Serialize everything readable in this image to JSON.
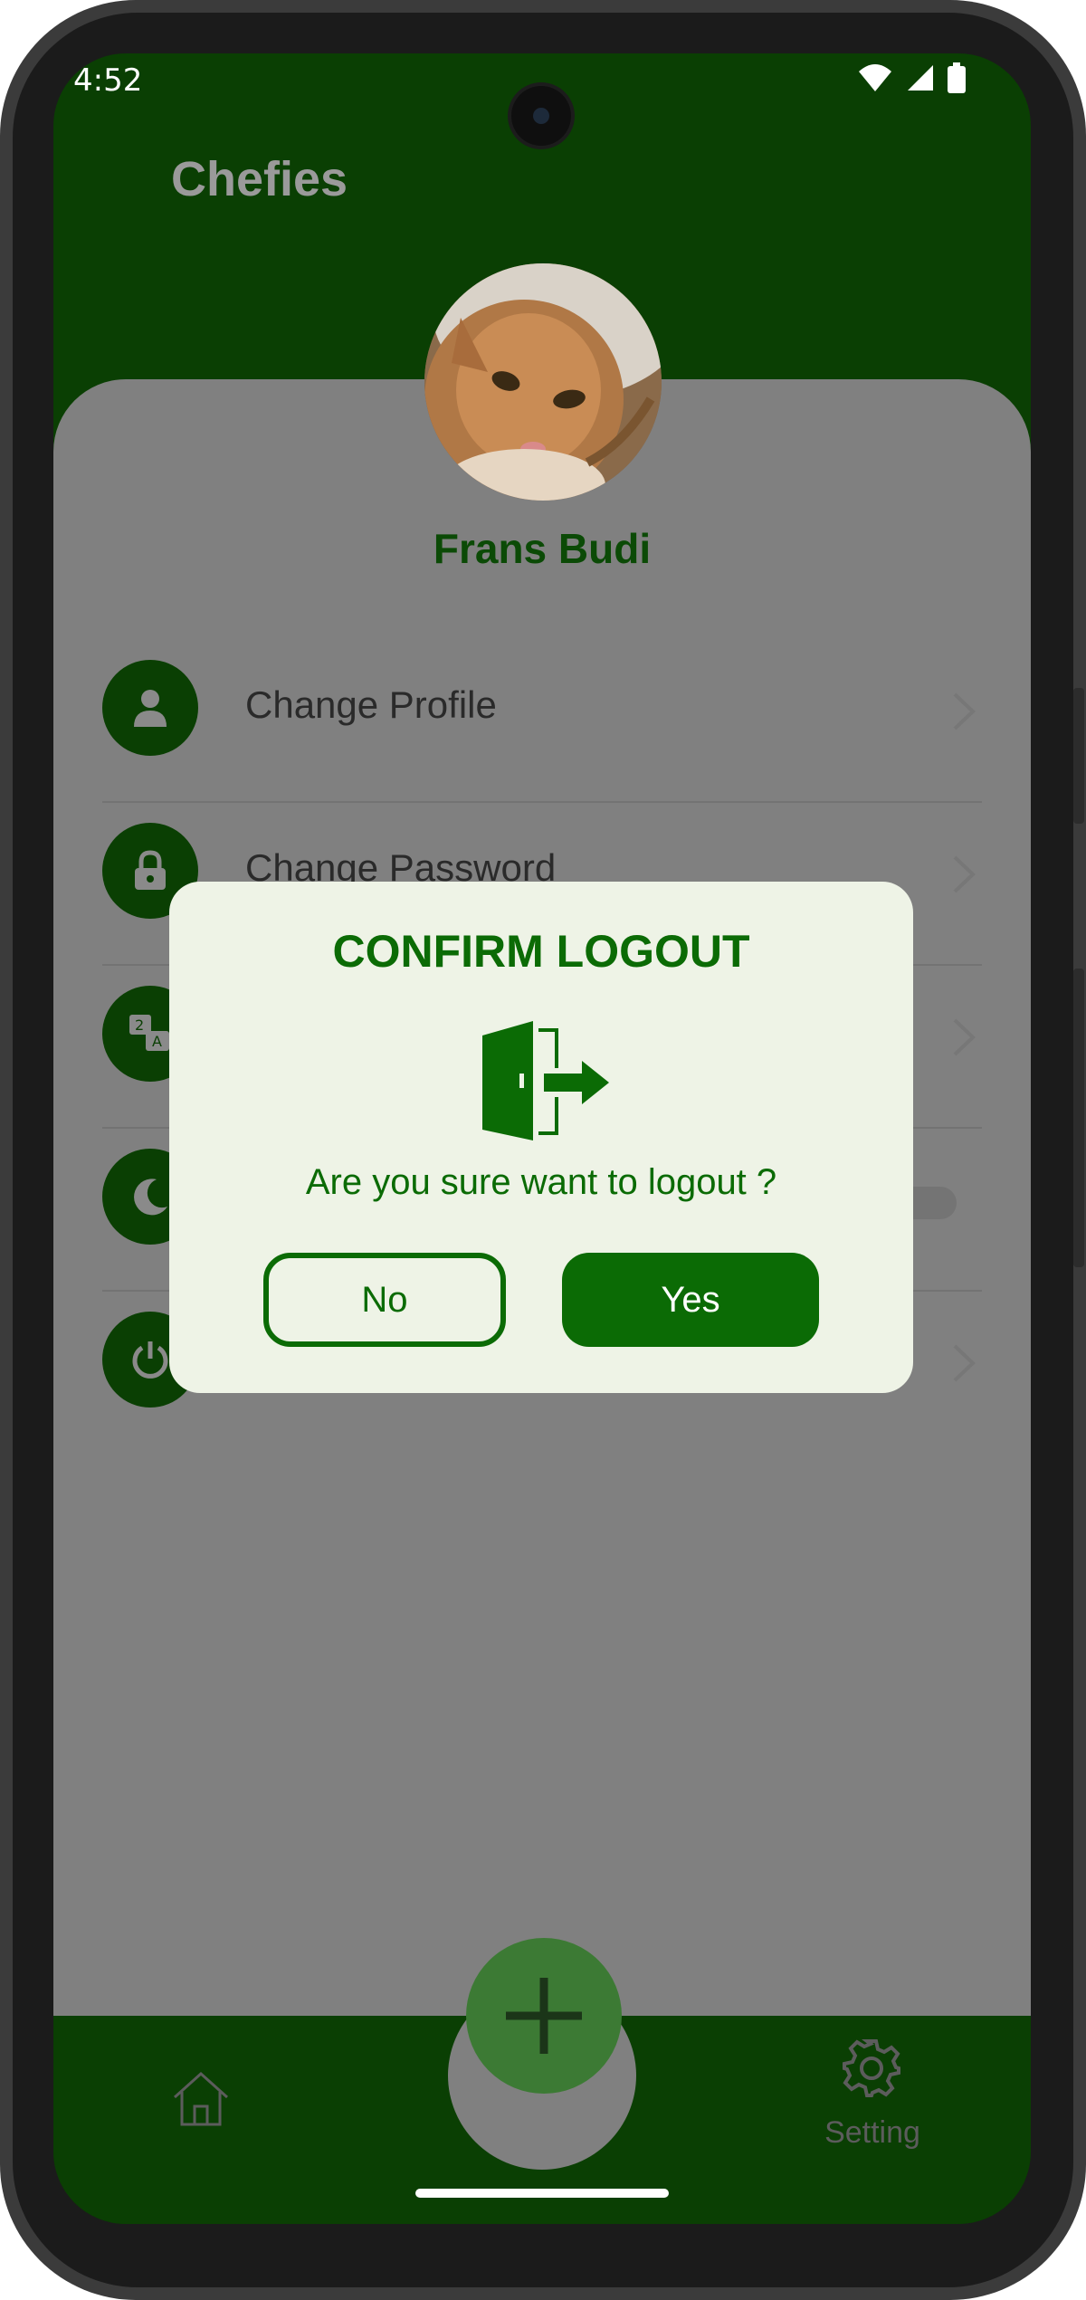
{
  "status_bar": {
    "time": "4:52",
    "icons": [
      "wifi-icon",
      "signal-icon",
      "battery-icon"
    ]
  },
  "app": {
    "title": "Chefies"
  },
  "profile": {
    "name": "Frans Budi",
    "avatar": "cat-photo"
  },
  "menu": {
    "items": [
      {
        "label": "Change Profile",
        "icon": "person-icon",
        "trailing": "chevron-right-icon"
      },
      {
        "label": "Change Password",
        "icon": "lock-icon",
        "trailing": "chevron-right-icon"
      },
      {
        "label": "",
        "icon": "translate-icon",
        "trailing": "chevron-right-icon"
      },
      {
        "label": "",
        "icon": "moon-icon",
        "trailing": "toggle-switch"
      },
      {
        "label": "",
        "icon": "power-icon",
        "trailing": "chevron-right-icon"
      }
    ]
  },
  "dialog": {
    "title": "CONFIRM LOGOUT",
    "icon": "logout-door-icon",
    "message": "Are you sure want to logout ?",
    "no_label": "No",
    "yes_label": "Yes"
  },
  "bottom_nav": {
    "home_icon": "home-icon",
    "setting_label": "Setting",
    "setting_icon": "gear-icon",
    "fab_icon": "plus-icon"
  },
  "colors": {
    "primary_dark": "#0a3f03",
    "primary": "#0b6b05",
    "dialog_bg": "#eef3e6",
    "scrim": "#808080"
  }
}
